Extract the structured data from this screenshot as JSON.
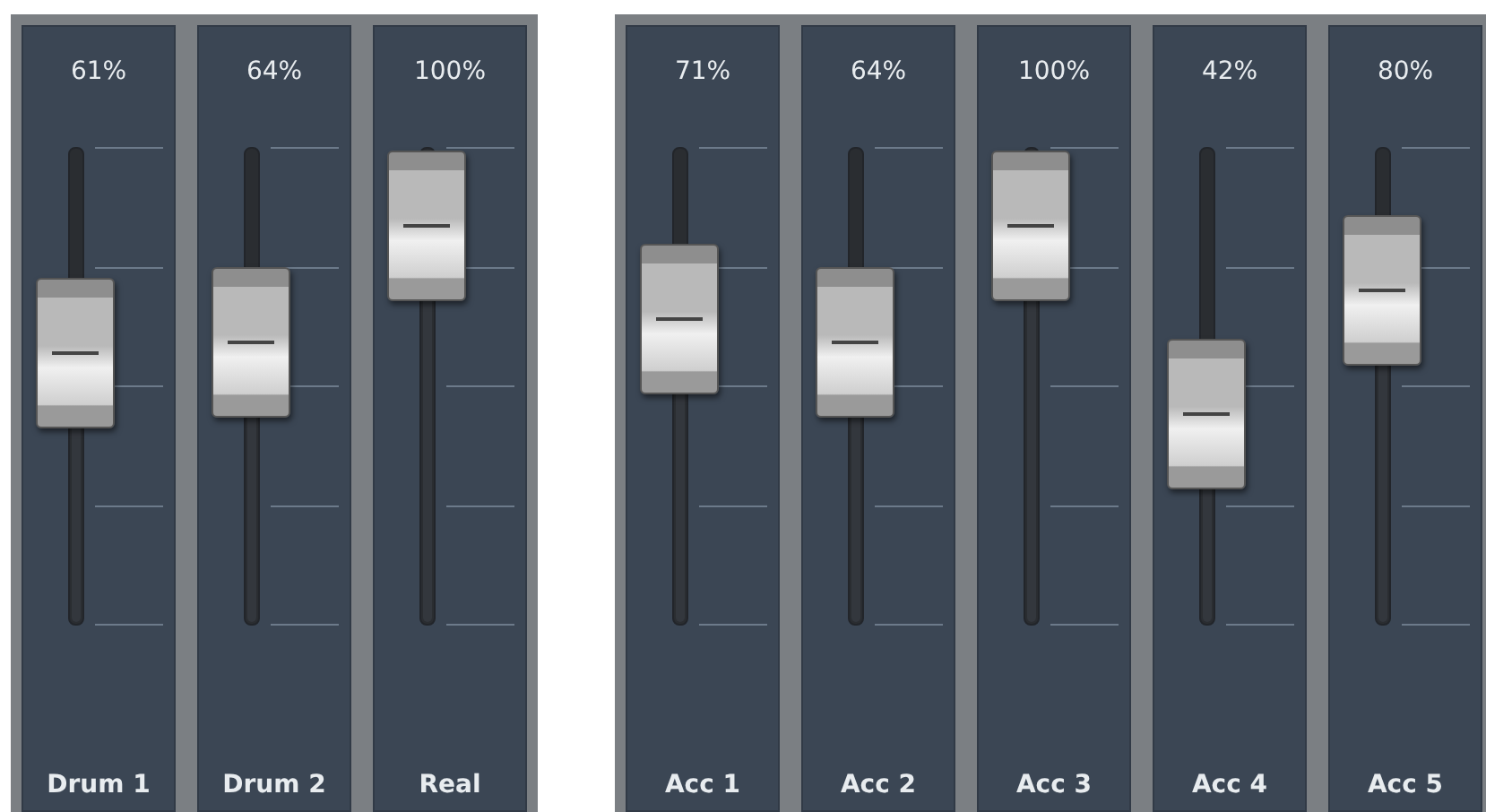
{
  "groups": [
    {
      "channels": [
        {
          "name": "Drum 1",
          "reading": "61%",
          "level": 0.61
        },
        {
          "name": "Drum 2",
          "reading": "64%",
          "level": 0.64
        },
        {
          "name": "Real",
          "reading": "100%",
          "level": 1.0
        }
      ]
    },
    {
      "channels": [
        {
          "name": "Acc 1",
          "reading": "71%",
          "level": 0.71
        },
        {
          "name": "Acc 2",
          "reading": "64%",
          "level": 0.64
        },
        {
          "name": "Acc 3",
          "reading": "100%",
          "level": 1.0
        },
        {
          "name": "Acc 4",
          "reading": "42%",
          "level": 0.42
        },
        {
          "name": "Acc 5",
          "reading": "80%",
          "level": 0.8
        }
      ]
    }
  ]
}
